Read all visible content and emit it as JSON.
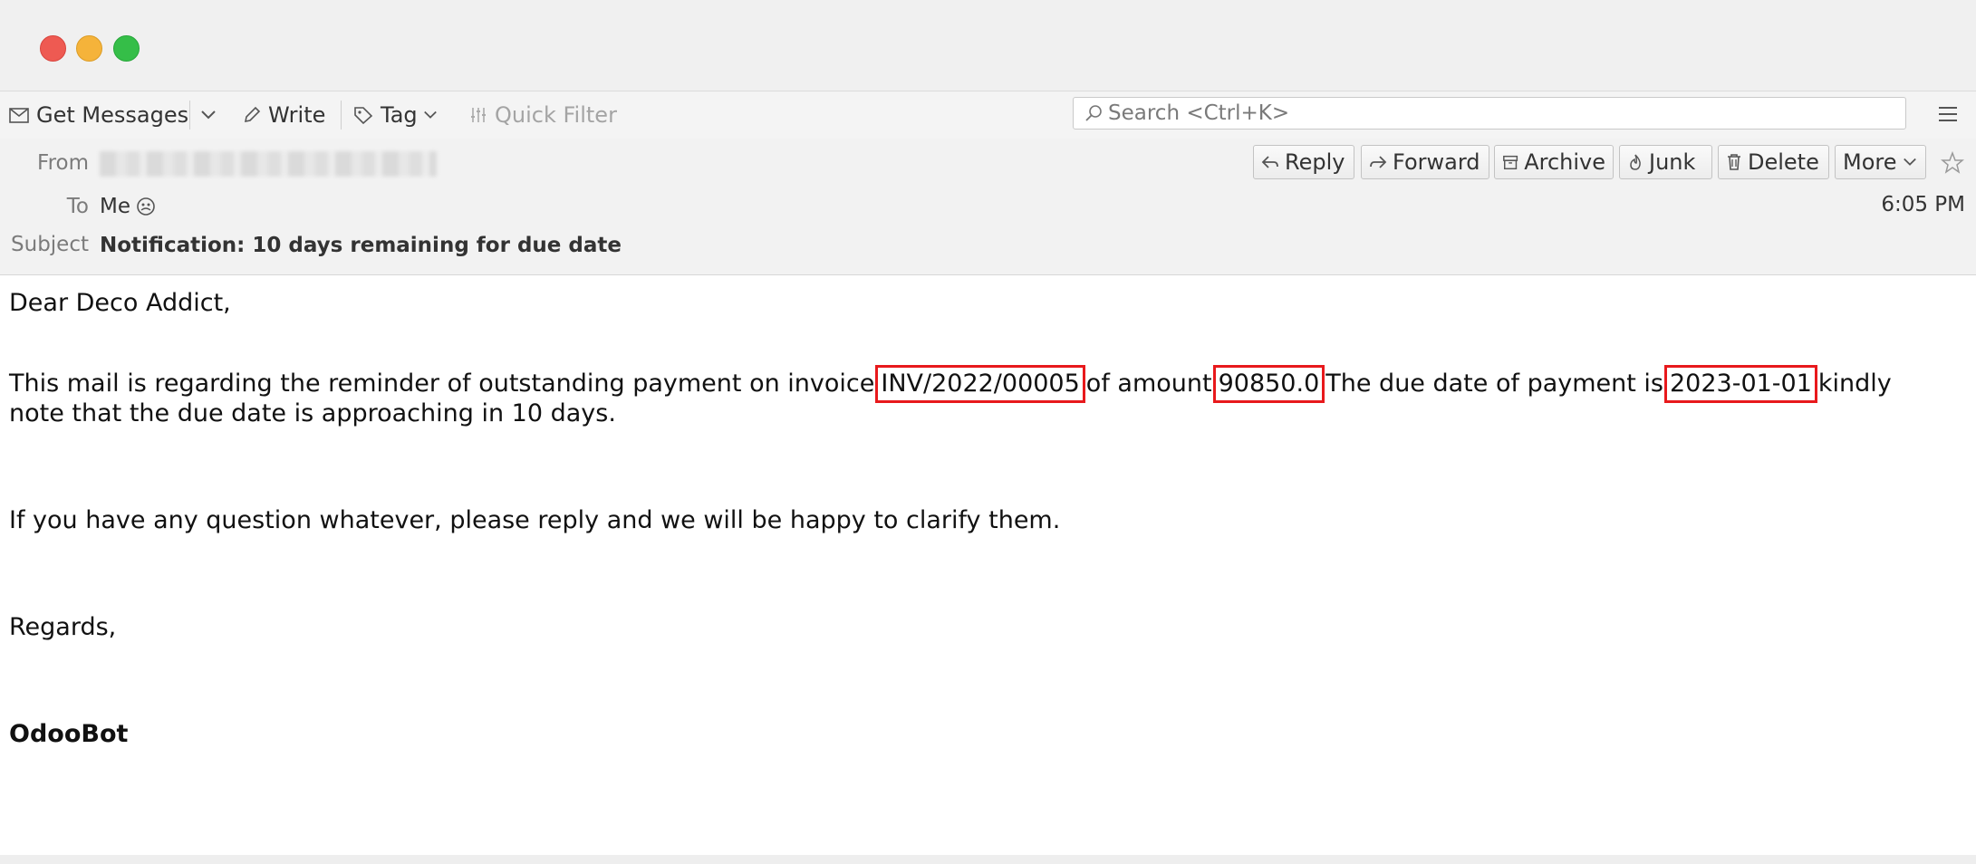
{
  "toolbar": {
    "get_messages": "Get Messages",
    "write": "Write",
    "tag": "Tag",
    "quick_filter": "Quick Filter",
    "search_placeholder": "Search <Ctrl+K>"
  },
  "header": {
    "from_label": "From",
    "to_label": "To",
    "to_value": "Me",
    "subject_label": "Subject",
    "subject_value": "Notification: 10 days remaining for due date",
    "time": "6:05 PM",
    "buttons": {
      "reply": "Reply",
      "forward": "Forward",
      "archive": "Archive",
      "junk": "Junk",
      "delete": "Delete",
      "more": "More"
    }
  },
  "body": {
    "greeting": "Dear Deco Addict,",
    "line1_pre": "This mail is regarding the reminder of outstanding payment on invoice",
    "invoice": "INV/2022/00005",
    "line1_mid1": "of amount",
    "amount": "90850.0",
    "line1_mid2": "The due date of payment is",
    "due_date": "2023-01-01",
    "line1_post": "kindly",
    "line2": "note that the due date is approaching in 10 days.",
    "question": "If you have any question whatever, please reply and we will be happy to clarify them.",
    "regards": "Regards,",
    "signature": "OdooBot"
  },
  "colors": {
    "highlight_box": "#e8191c",
    "close": "#ee5a52",
    "minimize": "#f5b33a",
    "maximize": "#35be48"
  }
}
